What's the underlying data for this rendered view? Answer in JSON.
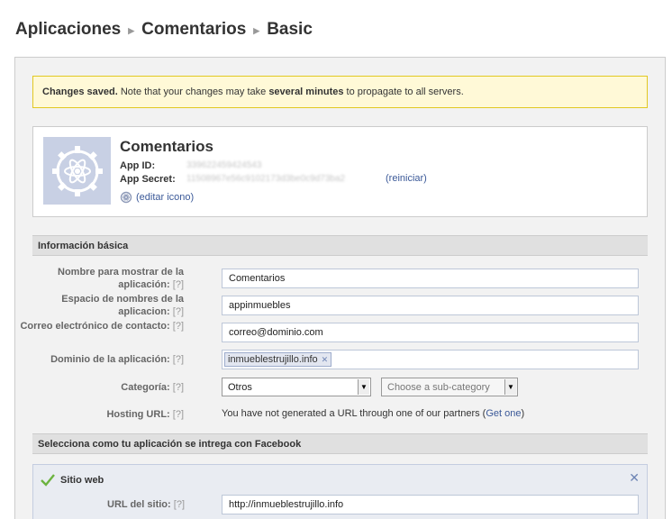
{
  "breadcrumb": [
    "Aplicaciones",
    "Comentarios",
    "Basic"
  ],
  "notice": {
    "bold1": "Changes saved.",
    "text1": " Note that your changes may take ",
    "bold2": "several minutes",
    "text2": " to propagate to all servers."
  },
  "app": {
    "name": "Comentarios",
    "id_label": "App ID:",
    "id_value": "339622459424543",
    "secret_label": "App Secret:",
    "secret_value": "11508967e56c9102173d3be0c9d73ba2",
    "reset_link": "(reiniciar)",
    "edit_icon_link": "(editar icono)",
    "icon": "atom-gear-icon"
  },
  "basic_info": {
    "header": "Información básica",
    "help": "[?]",
    "display_name_label": "Nombre para mostrar de la aplicación:",
    "display_name_value": "Comentarios",
    "namespace_label": "Espacio de nombres de la aplicacion:",
    "namespace_value": "appinmuebles",
    "email_label": "Correo electrónico de contacto:",
    "email_value": "correo@dominio.com",
    "domain_label": "Dominio de la aplicación:",
    "domain_token": "inmueblestrujillo.info",
    "category_label": "Categoría:",
    "category_value": "Otros",
    "subcategory_placeholder": "Choose a sub-category",
    "hosting_label": "Hosting URL:",
    "hosting_text": "You have not generated a URL through one of our partners",
    "hosting_link": "Get one"
  },
  "integration": {
    "header": "Selecciona como tu aplicación se intrega con Facebook",
    "website_title": "Sitio web",
    "site_url_label": "URL del sitio:",
    "site_url_value": "http://inmueblestrujillo.info"
  },
  "colors": {
    "link": "#3b5998",
    "notice_bg": "#fff9d7",
    "check": "#6cb33f"
  }
}
